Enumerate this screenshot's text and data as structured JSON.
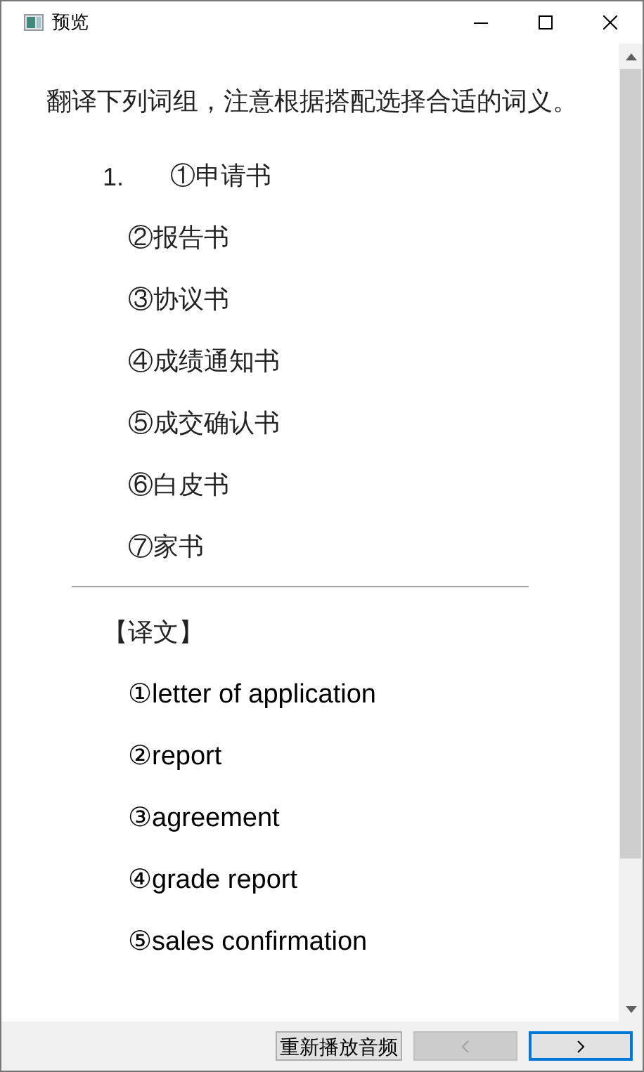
{
  "window": {
    "title": "预览"
  },
  "instruction": "翻译下列词组，注意根据搭配选择合适的词义。",
  "question": {
    "number": "1.",
    "items": [
      "①申请书",
      "②报告书",
      "③协议书",
      "④成绩通知书",
      "⑤成交确认书",
      "⑥白皮书",
      "⑦家书"
    ]
  },
  "translation": {
    "heading": "【译文】",
    "items": [
      "①letter of application",
      "②report",
      "③agreement",
      "④grade report",
      "⑤sales confirmation"
    ]
  },
  "footer": {
    "buttons": [
      {
        "kind": "text",
        "label": "重新播放音频",
        "disabled": false,
        "focused": false
      },
      {
        "kind": "prev",
        "disabled": true,
        "focused": false
      },
      {
        "kind": "next",
        "disabled": false,
        "focused": true
      }
    ]
  }
}
